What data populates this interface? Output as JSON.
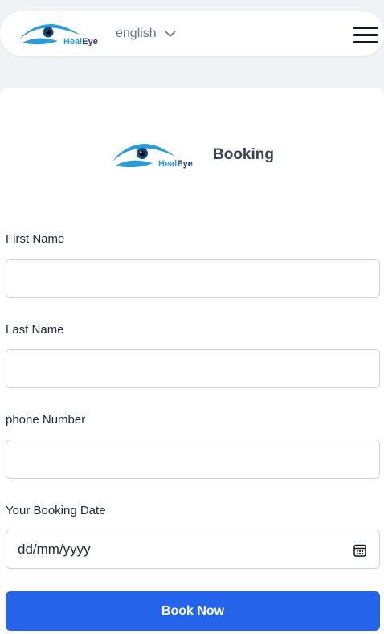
{
  "header": {
    "brand": {
      "text_heal": "Heal",
      "text_eye": "Eye"
    },
    "language": {
      "selected": "english"
    },
    "icons": {
      "menu": "hamburger-menu-icon",
      "chevron": "chevron-down-icon"
    }
  },
  "booking": {
    "title": "Booking",
    "logo": {
      "text_heal": "Heal",
      "text_eye": "Eye"
    },
    "fields": [
      {
        "label": "First Name",
        "value": ""
      },
      {
        "label": "Last Name",
        "value": ""
      },
      {
        "label": "phone Number",
        "value": ""
      },
      {
        "label": "Your Booking Date",
        "placeholder": "dd/mm/yyyy",
        "icon": "calendar-icon"
      }
    ],
    "submit_label": "Book Now"
  },
  "colors": {
    "accent": "#2563eb",
    "logo_blue": "#2b9cd8",
    "logo_dark": "#1e3a8a",
    "page_bg": "#f0f2f5"
  }
}
